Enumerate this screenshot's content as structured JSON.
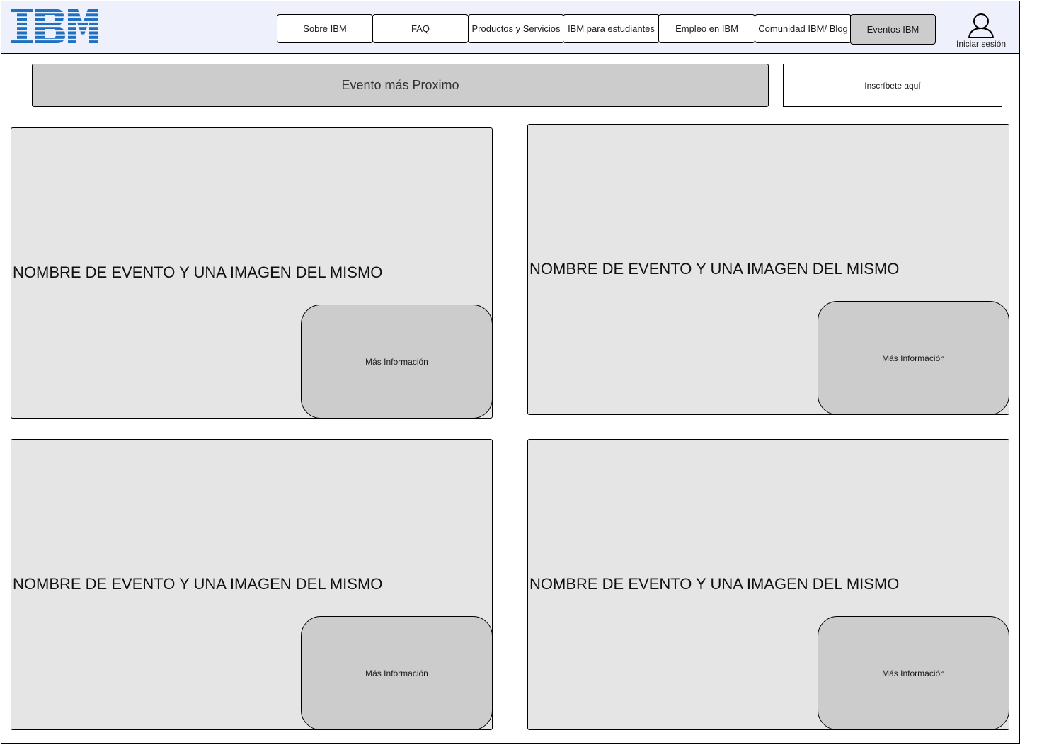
{
  "header": {
    "logo_text": "IBM",
    "brand_color": "#1f70c1",
    "nav": [
      {
        "label": "Sobre IBM",
        "active": false
      },
      {
        "label": "FAQ",
        "active": false
      },
      {
        "label": "Productos y Servicios",
        "active": false
      },
      {
        "label": "IBM para estudiantes",
        "active": false
      },
      {
        "label": "Empleo en IBM",
        "active": false
      },
      {
        "label": "Comunidad IBM/ Blog",
        "active": false
      },
      {
        "label": "Eventos IBM",
        "active": true
      }
    ],
    "login_label": "Iniciar sesión",
    "login_icon": "user-icon"
  },
  "main": {
    "next_event_label": "Evento más Proximo",
    "register_label": "Inscríbete aquí",
    "events": [
      {
        "title": "NOMBRE DE EVENTO Y UNA IMAGEN DEL MISMO",
        "button_label": "Más Información"
      },
      {
        "title": "NOMBRE DE EVENTO Y UNA IMAGEN DEL MISMO",
        "button_label": "Más Información"
      },
      {
        "title": "NOMBRE DE EVENTO Y UNA IMAGEN DEL MISMO",
        "button_label": "Más Información"
      },
      {
        "title": "NOMBRE DE EVENTO Y UNA IMAGEN DEL MISMO",
        "button_label": "Más Información"
      }
    ]
  }
}
